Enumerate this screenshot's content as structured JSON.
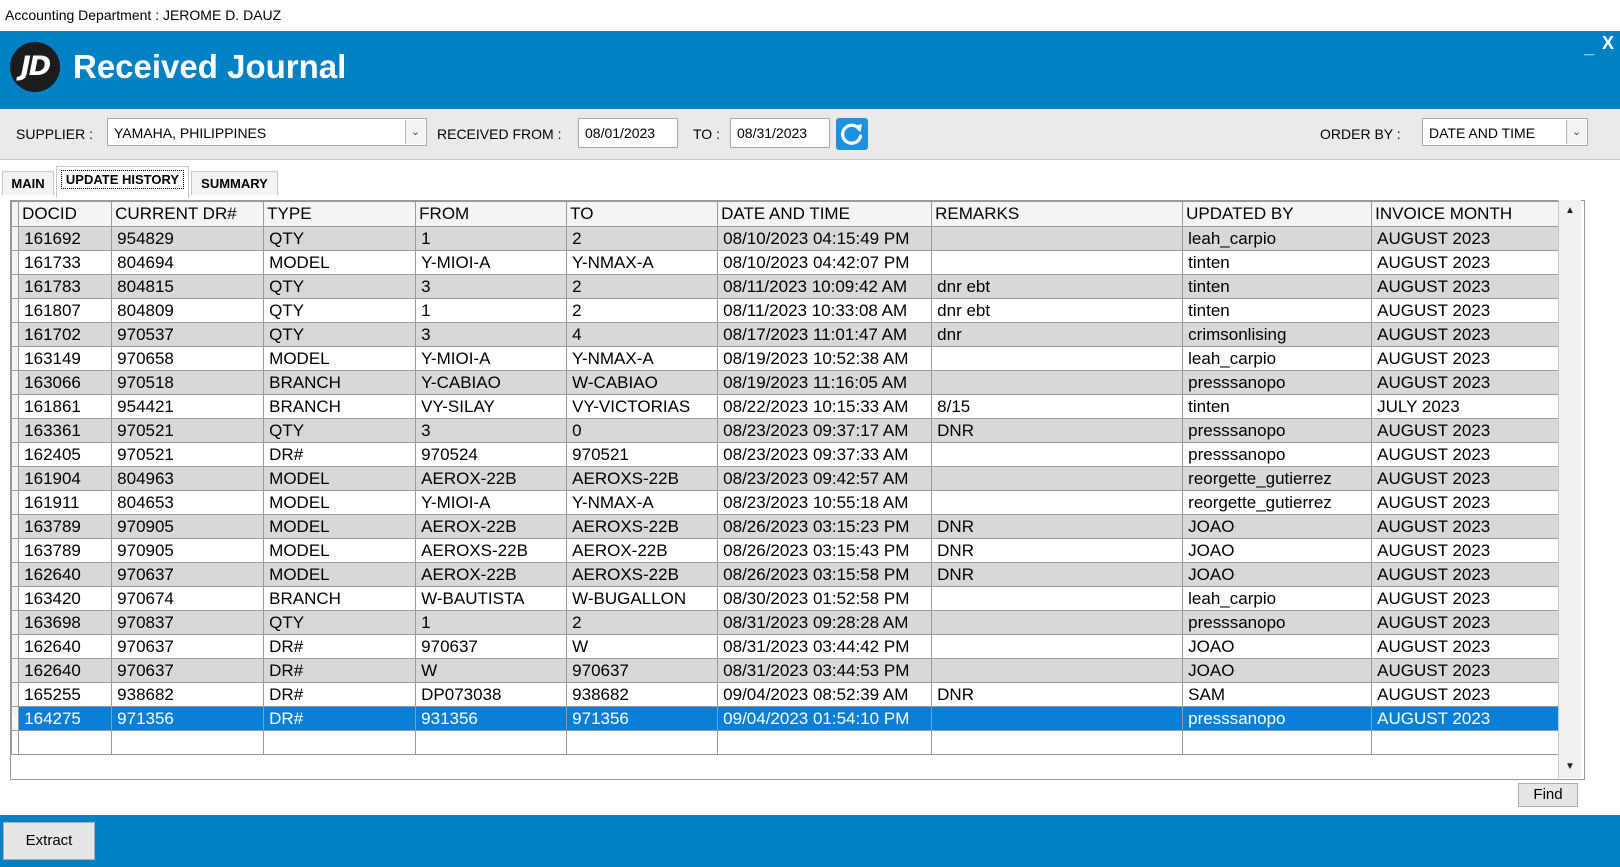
{
  "window": {
    "title": "Accounting Department : JEROME D. DAUZ",
    "minimize_label": "_",
    "close_label": "X"
  },
  "header": {
    "logo_text": "JD",
    "app_title": "Received Journal"
  },
  "filters": {
    "supplier_label": "SUPPLIER :",
    "supplier_value": "YAMAHA, PHILIPPINES",
    "received_from_label": "RECEIVED FROM :",
    "received_from_value": "08/01/2023",
    "to_label": "TO :",
    "to_value": "08/31/2023",
    "order_by_label": "ORDER BY :",
    "order_by_value": "DATE AND TIME"
  },
  "tabs": [
    {
      "label": "MAIN"
    },
    {
      "label": "UPDATE HISTORY",
      "active": true
    },
    {
      "label": "SUMMARY"
    }
  ],
  "grid": {
    "columns": [
      "DOCID",
      "CURRENT DR#",
      "TYPE",
      "FROM",
      "TO",
      "DATE AND TIME",
      "REMARKS",
      "UPDATED BY",
      "INVOICE MONTH"
    ],
    "rows": [
      [
        "161692",
        "954829",
        "QTY",
        "1",
        "2",
        "08/10/2023 04:15:49 PM",
        "",
        "leah_carpio",
        "AUGUST 2023"
      ],
      [
        "161733",
        "804694",
        "MODEL",
        "Y-MIOI-A",
        "Y-NMAX-A",
        "08/10/2023 04:42:07 PM",
        "",
        "tinten",
        "AUGUST 2023"
      ],
      [
        "161783",
        "804815",
        "QTY",
        "3",
        "2",
        "08/11/2023 10:09:42 AM",
        "dnr ebt",
        "tinten",
        "AUGUST 2023"
      ],
      [
        "161807",
        "804809",
        "QTY",
        "1",
        "2",
        "08/11/2023 10:33:08 AM",
        "dnr ebt",
        "tinten",
        "AUGUST 2023"
      ],
      [
        "161702",
        "970537",
        "QTY",
        "3",
        "4",
        "08/17/2023 11:01:47 AM",
        "dnr",
        "crimsonlising",
        "AUGUST 2023"
      ],
      [
        "163149",
        "970658",
        "MODEL",
        "Y-MIOI-A",
        "Y-NMAX-A",
        "08/19/2023 10:52:38 AM",
        "",
        "leah_carpio",
        "AUGUST 2023"
      ],
      [
        "163066",
        "970518",
        "BRANCH",
        "Y-CABIAO",
        "W-CABIAO",
        "08/19/2023 11:16:05 AM",
        "",
        "presssanopo",
        "AUGUST 2023"
      ],
      [
        "161861",
        "954421",
        "BRANCH",
        "VY-SILAY",
        "VY-VICTORIAS",
        "08/22/2023 10:15:33 AM",
        "8/15",
        "tinten",
        "JULY 2023"
      ],
      [
        "163361",
        "970521",
        "QTY",
        "3",
        "0",
        "08/23/2023 09:37:17 AM",
        "DNR",
        "presssanopo",
        "AUGUST 2023"
      ],
      [
        "162405",
        "970521",
        "DR#",
        "970524",
        "970521",
        "08/23/2023 09:37:33 AM",
        "",
        "presssanopo",
        "AUGUST 2023"
      ],
      [
        "161904",
        "804963",
        "MODEL",
        "AEROX-22B",
        "AEROXS-22B",
        "08/23/2023 09:42:57 AM",
        "",
        "reorgette_gutierrez",
        "AUGUST 2023"
      ],
      [
        "161911",
        "804653",
        "MODEL",
        "Y-MIOI-A",
        "Y-NMAX-A",
        "08/23/2023 10:55:18 AM",
        "",
        "reorgette_gutierrez",
        "AUGUST 2023"
      ],
      [
        "163789",
        "970905",
        "MODEL",
        "AEROX-22B",
        "AEROXS-22B",
        "08/26/2023 03:15:23 PM",
        "DNR",
        "JOAO",
        "AUGUST 2023"
      ],
      [
        "163789",
        "970905",
        "MODEL",
        "AEROXS-22B",
        "AEROX-22B",
        "08/26/2023 03:15:43 PM",
        "DNR",
        "JOAO",
        "AUGUST 2023"
      ],
      [
        "162640",
        "970637",
        "MODEL",
        "AEROX-22B",
        "AEROXS-22B",
        "08/26/2023 03:15:58 PM",
        "DNR",
        "JOAO",
        "AUGUST 2023"
      ],
      [
        "163420",
        "970674",
        "BRANCH",
        "W-BAUTISTA",
        "W-BUGALLON",
        "08/30/2023 01:52:58 PM",
        "",
        "leah_carpio",
        "AUGUST 2023"
      ],
      [
        "163698",
        "970837",
        "QTY",
        "1",
        "2",
        "08/31/2023 09:28:28 AM",
        "",
        "presssanopo",
        "AUGUST 2023"
      ],
      [
        "162640",
        "970637",
        "DR#",
        "970637",
        "W",
        "08/31/2023 03:44:42 PM",
        "",
        "JOAO",
        "AUGUST 2023"
      ],
      [
        "162640",
        "970637",
        "DR#",
        "W",
        "970637",
        "08/31/2023 03:44:53 PM",
        "",
        "JOAO",
        "AUGUST 2023"
      ],
      [
        "165255",
        "938682",
        "DR#",
        "DP073038",
        "938682",
        "09/04/2023 08:52:39 AM",
        "DNR",
        "SAM",
        "AUGUST 2023"
      ],
      [
        "164275",
        "971356",
        "DR#",
        "931356",
        "971356",
        "09/04/2023 01:54:10 PM",
        "",
        "presssanopo",
        "AUGUST 2023"
      ]
    ],
    "selected_row": 20
  },
  "buttons": {
    "find_label": "Find",
    "extract_label": "Extract"
  },
  "colors": {
    "brand": "#0080c5",
    "selection": "#0a7fd7",
    "row_alt": "#d8d8d8"
  }
}
